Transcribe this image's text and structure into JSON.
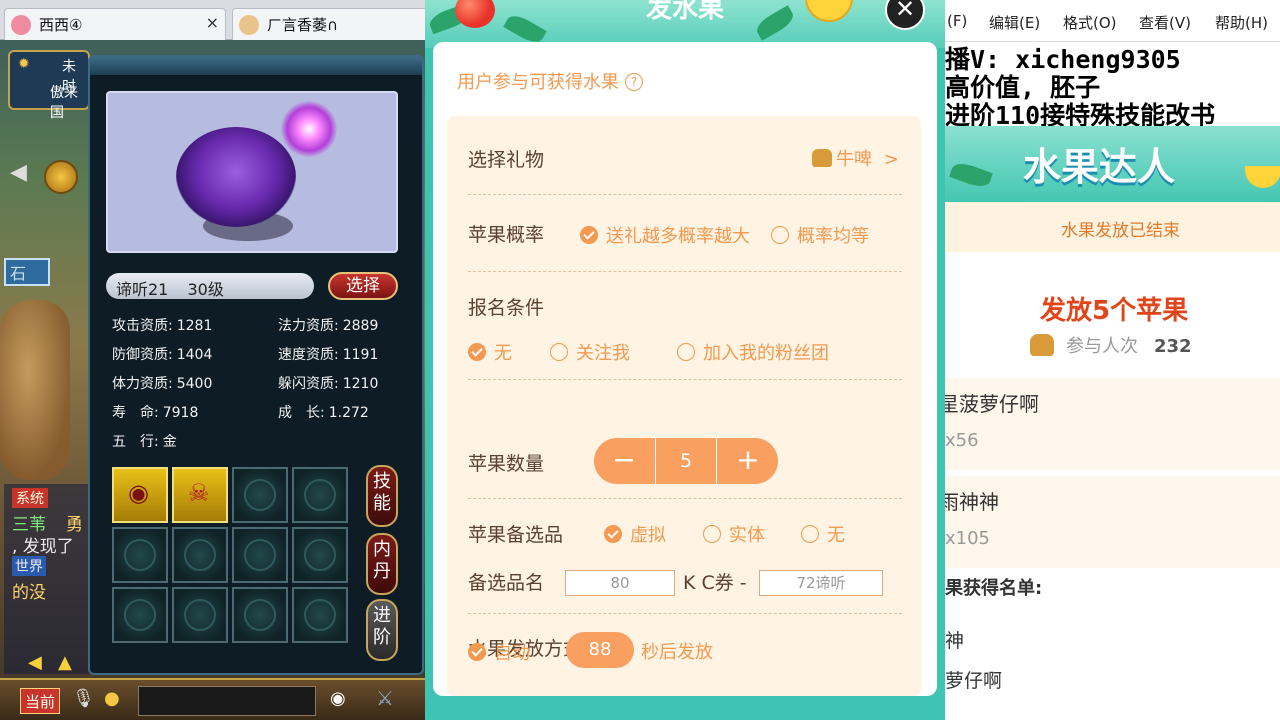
{
  "game": {
    "tabs": [
      {
        "label": "西西④",
        "close": "×"
      },
      {
        "label": "ㄏ言香萎∩",
        "close": ""
      }
    ],
    "topbar": {
      "line1": "未时",
      "line2": "傲来国"
    },
    "stone_label": "石",
    "chat": {
      "lines": [
        "系统",
        "三苇",
        "勇",
        ", 发现了",
        "世界",
        "的没"
      ]
    },
    "bottom": {
      "current": "当前"
    },
    "pet": {
      "name": "谛听21",
      "level": "30级",
      "select_label": "选择",
      "stats": [
        {
          "label": "攻击资质:",
          "value": "1281"
        },
        {
          "label": "法力资质:",
          "value": "2889"
        },
        {
          "label": "防御资质:",
          "value": "1404"
        },
        {
          "label": "速度资质:",
          "value": "1191"
        },
        {
          "label": "体力资质:",
          "value": "5400"
        },
        {
          "label": "躲闪资质:",
          "value": "1210"
        },
        {
          "label": "寿　命:",
          "value": "7918"
        },
        {
          "label": "成　长:",
          "value": "1.272"
        },
        {
          "label": "五　行:",
          "value": "金"
        }
      ],
      "side_tabs": [
        "技能",
        "内丹",
        "进阶"
      ]
    }
  },
  "modal": {
    "title": "发水果",
    "close_icon": "close-icon",
    "hint": "用户参与可获得水果",
    "gift": {
      "label": "选择礼物",
      "value": "牛啤",
      "arrow": ">"
    },
    "probability": {
      "label": "苹果概率",
      "options": [
        {
          "text": "送礼越多概率越大",
          "checked": true
        },
        {
          "text": "概率均等",
          "checked": false
        }
      ]
    },
    "condition": {
      "label": "报名条件",
      "options": [
        {
          "text": "无",
          "checked": true
        },
        {
          "text": "关注我",
          "checked": false
        },
        {
          "text": "加入我的粉丝团",
          "checked": false
        }
      ]
    },
    "quantity": {
      "label": "苹果数量",
      "minus": "−",
      "value": "5",
      "plus": "+"
    },
    "alt": {
      "label": "苹果备选品",
      "options": [
        {
          "text": "虚拟",
          "checked": true
        },
        {
          "text": "实体",
          "checked": false
        },
        {
          "text": "无",
          "checked": false
        }
      ]
    },
    "alt_name": {
      "label": "备选品名",
      "field1": "80",
      "middle": "K C券 -",
      "field2": "72谛听"
    },
    "method": {
      "label": "水果发放方式",
      "option": {
        "text": "自动",
        "checked": true
      },
      "seconds": "88",
      "suffix": "秒后发放"
    }
  },
  "right": {
    "menu": [
      "(F)",
      "编辑(E)",
      "格式(O)",
      "查看(V)",
      "帮助(H)"
    ],
    "notepad_lines": [
      "播V: xicheng9305",
      "高价值, 胚子",
      "进阶110接特殊技能改书"
    ],
    "banner_title": "水果达人",
    "ended": "水果发放已结束",
    "result_title": "发放5个苹果",
    "participants_label": "参与人次",
    "participants_count": "232",
    "winners": [
      {
        "name": "星菠萝仔啊",
        "qty": "x56"
      },
      {
        "name": "雨神神",
        "qty": "x105"
      }
    ],
    "list_title": "果获得名单:",
    "list_items": [
      "神",
      "萝仔啊"
    ]
  }
}
